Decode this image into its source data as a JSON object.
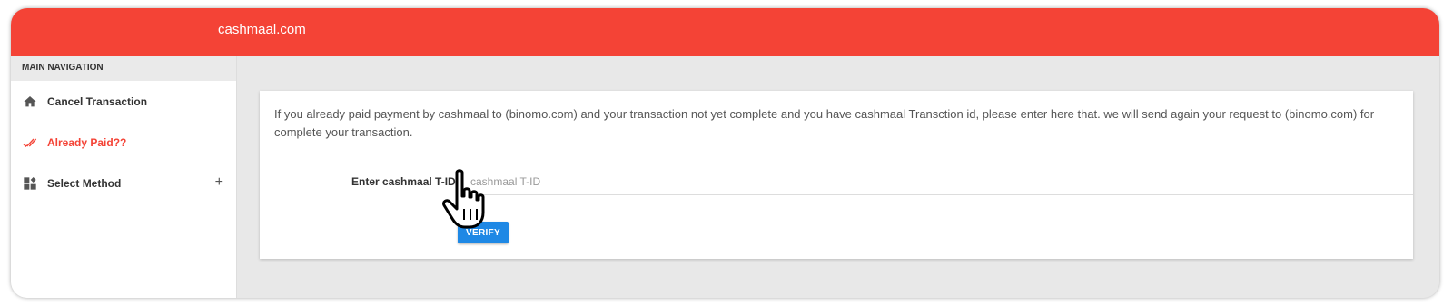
{
  "header": {
    "brand": "cashmaal.com",
    "background_color": "#f44336"
  },
  "sidebar": {
    "heading": "MAIN NAVIGATION",
    "items": [
      {
        "label": "Cancel Transaction",
        "icon": "home-icon",
        "active": false
      },
      {
        "label": "Already Paid??",
        "icon": "double-check-icon",
        "active": true
      },
      {
        "label": "Select Method",
        "icon": "widgets-icon",
        "active": false,
        "expand": "+"
      }
    ],
    "active_color": "#f44336"
  },
  "main": {
    "message": "If you already paid payment by cashmaal to (binomo.com) and your transaction not yet complete and you have cashmaal Transction id, please enter here that. we will send again your request to (binomo.com) for complete your transaction.",
    "field_label": "Enter cashmaal T-ID",
    "tid_input": {
      "value": "",
      "placeholder": "cashmaal T-ID"
    },
    "verify_label": "VERIFY",
    "button_color": "#1e88e5"
  },
  "cursor": {
    "icon": "hand-pointer-cursor-icon"
  }
}
